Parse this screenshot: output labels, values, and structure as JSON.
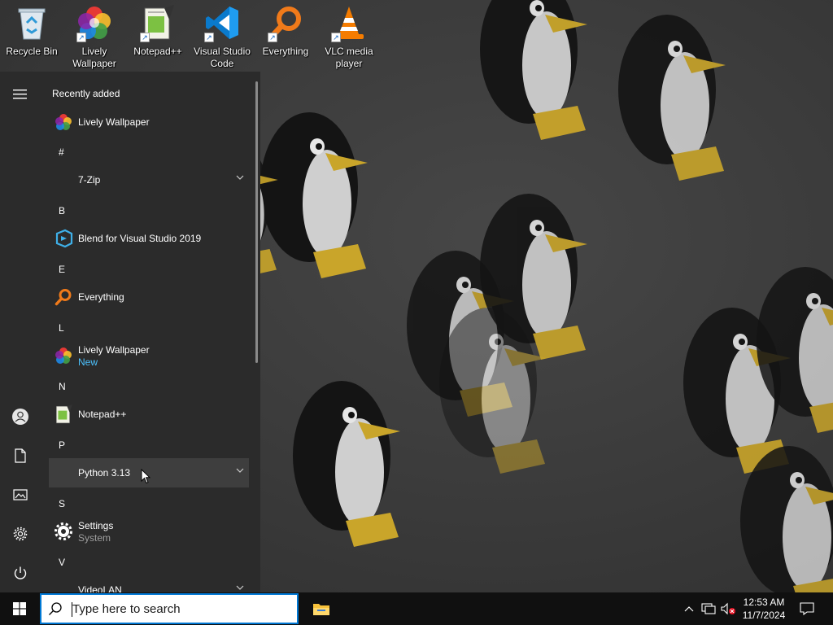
{
  "desktop": {
    "icons": [
      {
        "label": "Recycle Bin",
        "icon": "recycle-bin-icon"
      },
      {
        "label": "Lively Wallpaper",
        "icon": "lively-wallpaper-icon"
      },
      {
        "label": "Notepad++",
        "icon": "notepad-plus-plus-icon"
      },
      {
        "label": "Visual Studio Code",
        "icon": "vscode-icon"
      },
      {
        "label": "Everything",
        "icon": "everything-search-icon"
      },
      {
        "label": "VLC media player",
        "icon": "vlc-cone-icon"
      }
    ]
  },
  "start_menu": {
    "recently_added_label": "Recently added",
    "recent": [
      {
        "name": "Lively Wallpaper",
        "icon": "lively-wallpaper-icon"
      }
    ],
    "groups": [
      {
        "letter": "#",
        "apps": [
          {
            "name": "7-Zip",
            "expandable": true
          }
        ]
      },
      {
        "letter": "B",
        "apps": [
          {
            "name": "Blend for Visual Studio 2019",
            "icon": "blend-icon"
          }
        ]
      },
      {
        "letter": "E",
        "apps": [
          {
            "name": "Everything",
            "icon": "everything-search-icon"
          }
        ]
      },
      {
        "letter": "L",
        "apps": [
          {
            "name": "Lively Wallpaper",
            "sub": "New",
            "icon": "lively-wallpaper-icon"
          }
        ]
      },
      {
        "letter": "N",
        "apps": [
          {
            "name": "Notepad++",
            "icon": "notepad-plus-plus-icon"
          }
        ]
      },
      {
        "letter": "P",
        "apps": [
          {
            "name": "Python 3.13",
            "expandable": true,
            "hovered": true
          }
        ]
      },
      {
        "letter": "S",
        "apps": [
          {
            "name": "Settings",
            "sub": "System",
            "icon": "gear-icon"
          }
        ]
      },
      {
        "letter": "V",
        "apps": [
          {
            "name": "VideoLAN",
            "expandable": true
          }
        ]
      }
    ],
    "rail": [
      "hamburger-icon",
      "user-icon",
      "documents-icon",
      "pictures-icon",
      "settings-icon",
      "power-icon"
    ]
  },
  "taskbar": {
    "search_placeholder": "Type here to search",
    "time": "12:53 AM",
    "date": "11/7/2024"
  },
  "colors": {
    "start_bg": "#2b2b2b",
    "taskbar_bg": "#101010",
    "accent": "#0078d4",
    "new_badge": "#4cc2ff"
  }
}
